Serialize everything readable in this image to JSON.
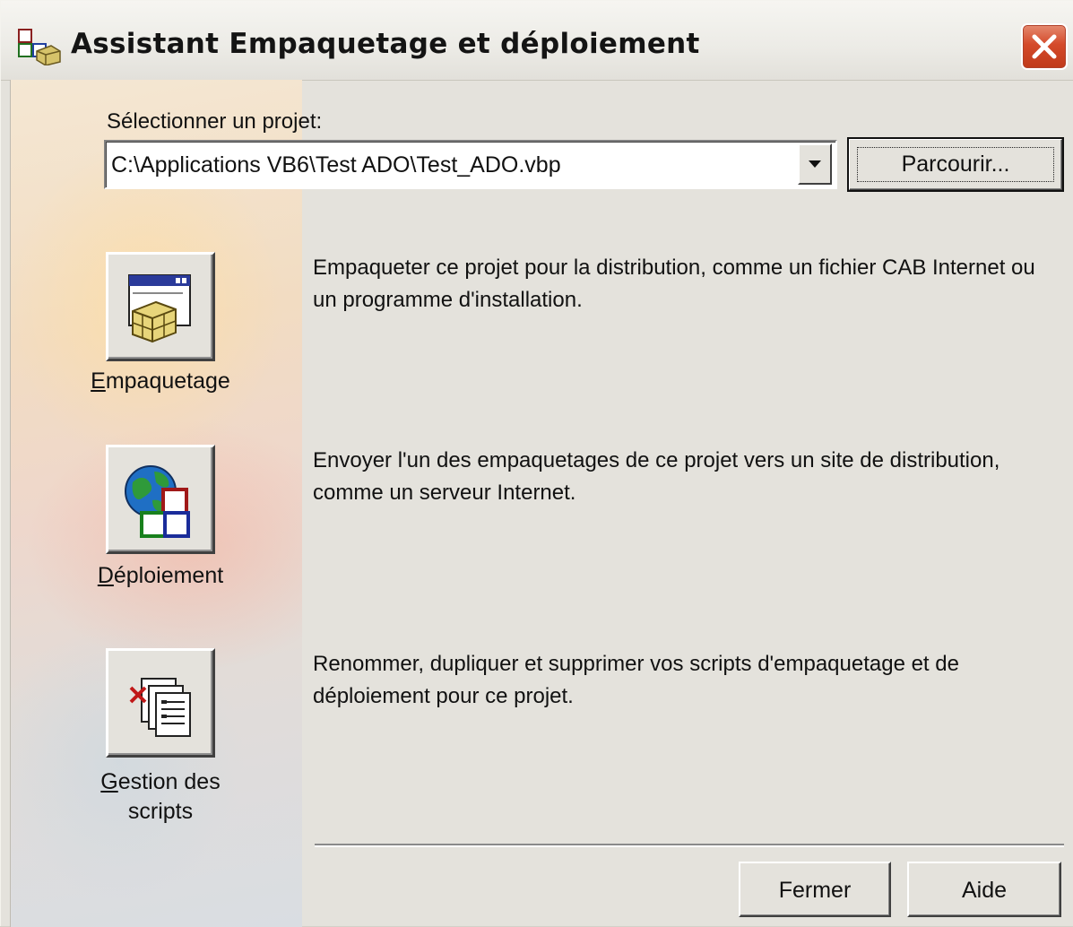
{
  "window": {
    "title": "Assistant Empaquetage et déploiement",
    "icon": "package-wizard-icon",
    "close_icon": "close-icon"
  },
  "project": {
    "label": "Sélectionner un projet:",
    "selected_value": "C:\\Applications VB6\\Test ADO\\Test_ADO.vbp",
    "browse_label": "Parcourir..."
  },
  "actions": [
    {
      "icon": "package-icon",
      "label_accel": "E",
      "label_rest": "mpaquetage",
      "description": "Empaqueter ce projet pour la distribution, comme un fichier CAB Internet ou un programme d'installation."
    },
    {
      "icon": "deploy-globe-icon",
      "label_accel": "D",
      "label_rest": "éploiement",
      "description": "Envoyer l'un des empaquetages de ce projet vers un site de distribution, comme un serveur Internet."
    },
    {
      "icon": "manage-scripts-icon",
      "label_accel": "G",
      "label_rest": "estion des",
      "label_line2": "scripts",
      "description": "Renommer, dupliquer et supprimer vos scripts d'empaquetage et de déploiement pour ce projet."
    }
  ],
  "footer": {
    "close_label": "Fermer",
    "help_label": "Aide"
  },
  "colors": {
    "dialog_bg": "#e4e2dc",
    "close_button": "#d44a2a"
  }
}
